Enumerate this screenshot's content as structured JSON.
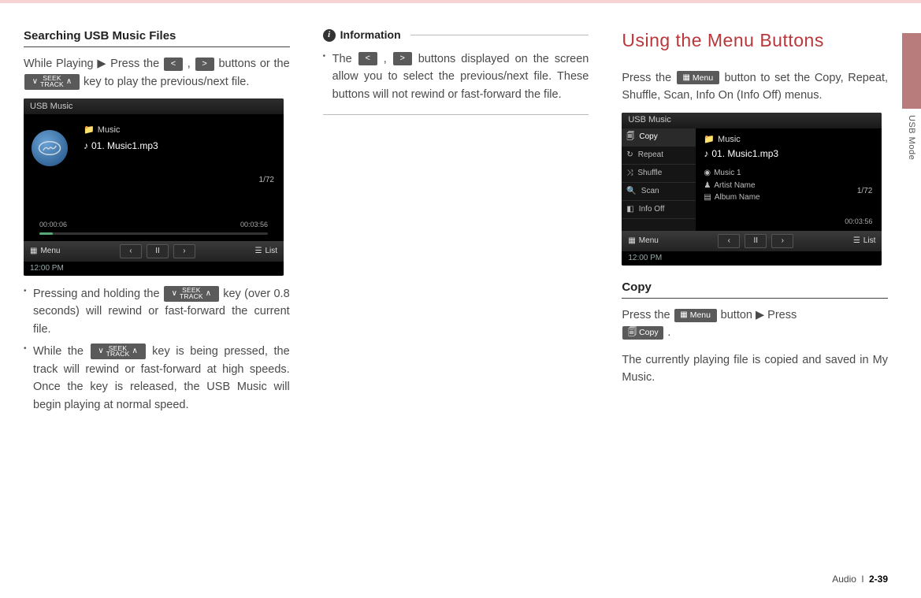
{
  "sideLabel": "USB Mode",
  "footer": {
    "section": "Audio",
    "sep": "l",
    "page": "2-39"
  },
  "col1": {
    "heading": "Searching USB Music Files",
    "intro_a": "While Playing ▶ Press the ",
    "intro_b": " , ",
    "intro_c": " buttons or the ",
    "intro_d": " key to play the previous/next file.",
    "key_prev": "<",
    "key_next": ">",
    "key_seek_top": "SEEK",
    "key_seek_bot": "TRACK",
    "bullets": [
      {
        "a": "Pressing and holding the ",
        "b": " key (over 0.8 seconds) will rewind or fast-forward the current file."
      },
      {
        "a": "While the ",
        "b": " key is being pressed, the track will rewind or fast-forward at high speeds. Once the key is released, the USB Music will begin playing at normal speed."
      }
    ],
    "shot": {
      "title": "USB  Music",
      "folder": "Music",
      "file": "01. Music1.mp3",
      "counter": "1/72",
      "t_cur": "00:00:06",
      "t_end": "00:03:56",
      "menu": "Menu",
      "list": "List",
      "clock": "12:00 PM"
    }
  },
  "col2": {
    "info_label": "Information",
    "bullet_a": "The ",
    "bullet_b": " , ",
    "bullet_c": " buttons displayed on the screen allow you to select the previous/next file. These buttons will not rewind or fast-forward the file.",
    "key_prev": "<",
    "key_next": ">"
  },
  "col3": {
    "title": "Using the Menu Buttons",
    "p1_a": "Press the ",
    "p1_b": " button to set the Copy, Repeat, Shuffle, Scan, Info On (Info Off) menus.",
    "menu_label": "Menu",
    "copy_heading": "Copy",
    "copy_a": "Press the ",
    "copy_b": " button ▶ Press ",
    "copy_label": "Copy",
    "copy_note": "The currently playing file is copied and saved in My Music.",
    "shot": {
      "title": "USB  Music",
      "menuItems": [
        "Copy",
        "Repeat",
        "Shuffle",
        "Scan",
        "Info Off"
      ],
      "folder": "Music",
      "file": "01. Music1.mp3",
      "song": "Music 1",
      "artist": "Artist Name",
      "album": "Album Name",
      "counter": "1/72",
      "t_end": "00:03:56",
      "menu": "Menu",
      "list": "List",
      "clock": "12:00 PM"
    }
  }
}
